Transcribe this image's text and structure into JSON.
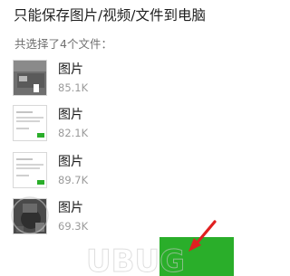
{
  "header": {
    "title": "只能保存图片/视频/文件到电脑"
  },
  "selection": {
    "summary": "共选择了4个文件："
  },
  "files": [
    {
      "name": "图片",
      "size": "85.1K",
      "thumb": "dark-photo"
    },
    {
      "name": "图片",
      "size": "82.1K",
      "thumb": "screenshot"
    },
    {
      "name": "图片",
      "size": "89.7K",
      "thumb": "screenshot"
    },
    {
      "name": "图片",
      "size": "69.3K",
      "thumb": "dark-photo"
    }
  ],
  "colors": {
    "button_green": "#2aae2a",
    "arrow_red": "#e02020",
    "watermark": "#c9c9c9"
  },
  "icons": {
    "annotation_arrow": "red-arrow-icon"
  }
}
